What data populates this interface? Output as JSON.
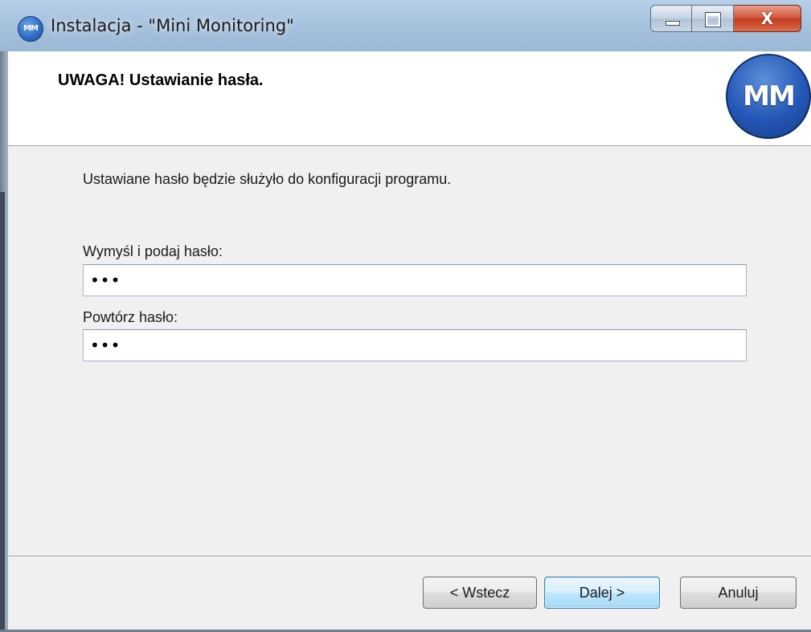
{
  "window": {
    "title": "Instalacja - \"Mini Monitoring\"",
    "icon": "mini-monitoring-logo-icon",
    "icon_text": "MM"
  },
  "caption_buttons": {
    "minimize": "minimize-icon",
    "maximize": "maximize-icon",
    "close_symbol": "X"
  },
  "header": {
    "title": "UWAGA! Ustawianie hasła.",
    "logo_text": "MM"
  },
  "body": {
    "description": "Ustawiane hasło będzie służyło do konfiguracji programu.",
    "password_label": "Wymyśl i podaj hasło:",
    "password_value": "•••",
    "confirm_label": "Powtórz hasło:",
    "confirm_value": "•••"
  },
  "footer": {
    "back_label": "< Wstecz",
    "next_label": "Dalej >",
    "cancel_label": "Anuluj"
  }
}
